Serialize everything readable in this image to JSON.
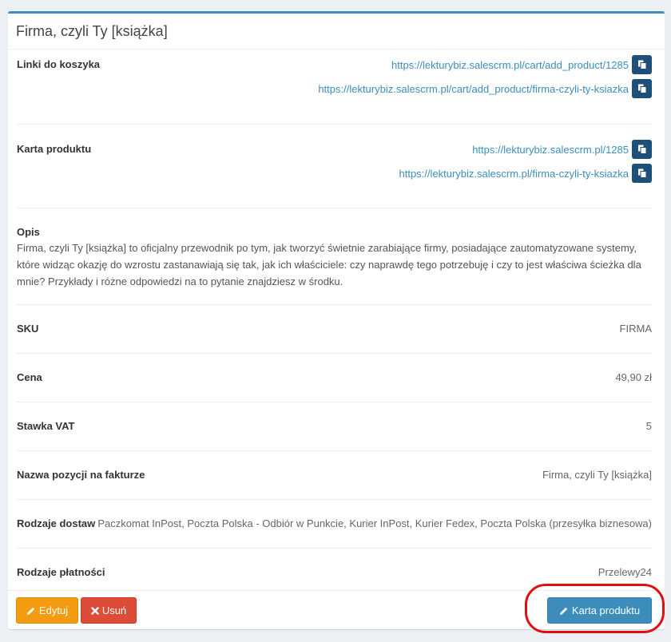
{
  "header": {
    "title": "Firma, czyli Ty [książka]"
  },
  "cart_links": {
    "label": "Linki do koszyka",
    "links": [
      "https://lekturybiz.salescrm.pl/cart/add_product/1285",
      "https://lekturybiz.salescrm.pl/cart/add_product/firma-czyli-ty-ksiazka"
    ]
  },
  "product_card": {
    "label": "Karta produktu",
    "links": [
      "https://lekturybiz.salescrm.pl/1285",
      "https://lekturybiz.salescrm.pl/firma-czyli-ty-ksiazka"
    ]
  },
  "description": {
    "label": "Opis",
    "text": "Firma, czyli Ty [książka] to oficjalny przewodnik po tym, jak tworzyć świetnie zarabiające firmy, posiadające zautomatyzowane systemy, które widząc okazję do wzrostu zastanawiają się tak, jak ich właściciele: czy naprawdę tego potrzebuję i czy to jest właściwa ścieżka dla mnie? Przykłady i różne odpowiedzi na to pytanie znajdziesz w środku."
  },
  "fields": {
    "sku": {
      "label": "SKU",
      "value": "FIRMA"
    },
    "price": {
      "label": "Cena",
      "value": "49,90 zł"
    },
    "vat": {
      "label": "Stawka VAT",
      "value": "5"
    },
    "invoice_name": {
      "label": "Nazwa pozycji na fakturze",
      "value": "Firma, czyli Ty [książka]"
    },
    "delivery": {
      "label": "Rodzaje dostaw",
      "value": "Paczkomat InPost, Poczta Polska - Odbiór w Punkcie, Kurier InPost, Kurier Fedex, Poczta Polska (przesyłka biznesowa)"
    },
    "payment": {
      "label": "Rodzaje płatności",
      "value": "Przelewy24"
    }
  },
  "footer": {
    "edit_label": "Edytuj",
    "delete_label": "Usuń",
    "product_card_label": "Karta produktu"
  },
  "colors": {
    "accent": "#3c8dbc",
    "copy_button": "#1e4f78",
    "warning": "#f39c12",
    "danger": "#dd4b39",
    "annotation": "#e01010"
  }
}
